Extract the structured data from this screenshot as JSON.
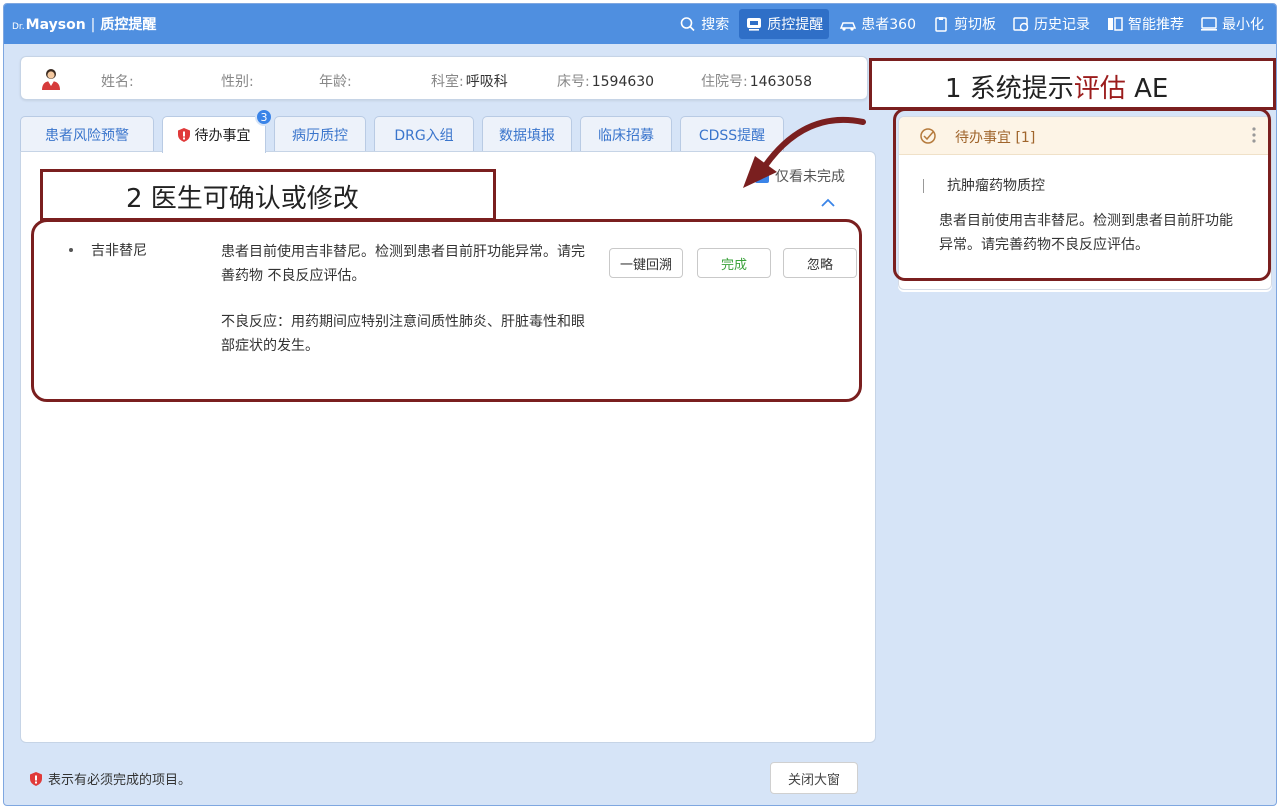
{
  "app": {
    "brand_prefix": "Dr.",
    "brand_name": "Mayson",
    "separator": "|",
    "title": "质控提醒"
  },
  "nav": [
    {
      "label": "搜索",
      "icon": "search-icon",
      "active": false
    },
    {
      "label": "质控提醒",
      "icon": "reminder-icon",
      "active": true
    },
    {
      "label": "患者360",
      "icon": "patient360-icon",
      "active": false
    },
    {
      "label": "剪切板",
      "icon": "clipboard-icon",
      "active": false
    },
    {
      "label": "历史记录",
      "icon": "history-icon",
      "active": false
    },
    {
      "label": "智能推荐",
      "icon": "recommend-icon",
      "active": false
    },
    {
      "label": "最小化",
      "icon": "minimize-icon",
      "active": false
    }
  ],
  "patient": {
    "name_label": "姓名:",
    "name_value": "",
    "gender_label": "性别:",
    "gender_value": "",
    "age_label": "年龄:",
    "age_value": "",
    "dept_label": "科室:",
    "dept_value": "呼吸科",
    "bed_label": "床号:",
    "bed_value": "1594630",
    "admission_label": "住院号:",
    "admission_value": "1463058"
  },
  "tabs": [
    {
      "label": "患者风险预警",
      "active": false
    },
    {
      "label": "待办事宜",
      "active": true,
      "badge": "3"
    },
    {
      "label": "病历质控",
      "active": false
    },
    {
      "label": "DRG入组",
      "active": false
    },
    {
      "label": "数据填报",
      "active": false
    },
    {
      "label": "临床招募",
      "active": false
    },
    {
      "label": "CDSS提醒",
      "active": false
    }
  ],
  "main": {
    "only_unfinished_label": "仅看未完成",
    "item": {
      "drug": "吉非替尼",
      "desc_line1": "患者目前使用吉非替尼。检测到患者目前肝功能异常。请完善药物 不良反应评估。",
      "desc_line2": "不良反应：用药期间应特别注意间质性肺炎、肝脏毒性和眼部症状的发生。",
      "btn_trace": "一键回溯",
      "btn_done": "完成",
      "btn_ignore": "忽略"
    },
    "legend": "表示有必须完成的项目。",
    "close_button": "关闭大窗"
  },
  "right_panel": {
    "title": "待办事宜 [1]",
    "subtitle": "抗肿瘤药物质控",
    "text": "患者目前使用吉非替尼。检测到患者目前肝功能异常。请完善药物不良反应评估。"
  },
  "annotations": {
    "label1_prefix": "1  系统提示",
    "label1_highlight": "评估",
    "label1_suffix": " AE",
    "label2": "2   医生可确认或修改"
  },
  "colors": {
    "titlebar": "#4f8fe0",
    "accent": "#3a84e8",
    "annotation": "#7a1f1f",
    "required": "#e03a3a",
    "done": "#3aa13a"
  }
}
